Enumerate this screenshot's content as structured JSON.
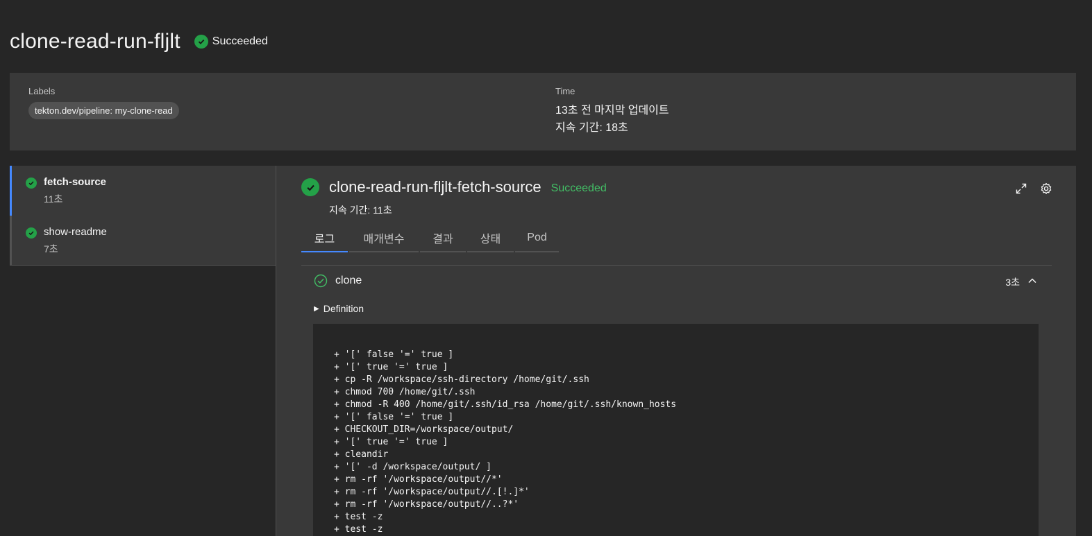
{
  "header": {
    "title": "clone-read-run-fljlt",
    "status": "Succeeded"
  },
  "info": {
    "labels_heading": "Labels",
    "label_tag": "tekton.dev/pipeline: my-clone-read",
    "time_heading": "Time",
    "last_updated": "13초 전 마지막 업데이트",
    "duration": "지속 기간: 18초"
  },
  "tasks": [
    {
      "name": "fetch-source",
      "duration": "11초",
      "selected": true
    },
    {
      "name": "show-readme",
      "duration": "7초",
      "selected": false
    }
  ],
  "detail": {
    "title": "clone-read-run-fljlt-fetch-source",
    "status": "Succeeded",
    "duration": "지속 기간: 11초",
    "tabs": [
      "로그",
      "매개변수",
      "결과",
      "상태",
      "Pod"
    ],
    "step": {
      "name": "clone",
      "duration": "3초"
    },
    "definition_label": "Definition",
    "log_lines": [
      "+ '[' false '=' true ]",
      "+ '[' true '=' true ]",
      "+ cp -R /workspace/ssh-directory /home/git/.ssh",
      "+ chmod 700 /home/git/.ssh",
      "+ chmod -R 400 /home/git/.ssh/id_rsa /home/git/.ssh/known_hosts",
      "+ '[' false '=' true ]",
      "+ CHECKOUT_DIR=/workspace/output/",
      "+ '[' true '=' true ]",
      "+ cleandir",
      "+ '[' -d /workspace/output/ ]",
      "+ rm -rf '/workspace/output//*'",
      "+ rm -rf '/workspace/output//.[!.]*'",
      "+ rm -rf '/workspace/output//..?*'",
      "+ test -z",
      "+ test -z"
    ]
  },
  "colors": {
    "success": "#24a148",
    "success_text": "#42be65",
    "accent": "#4589ff",
    "background": "#262626",
    "panel": "#393939"
  }
}
